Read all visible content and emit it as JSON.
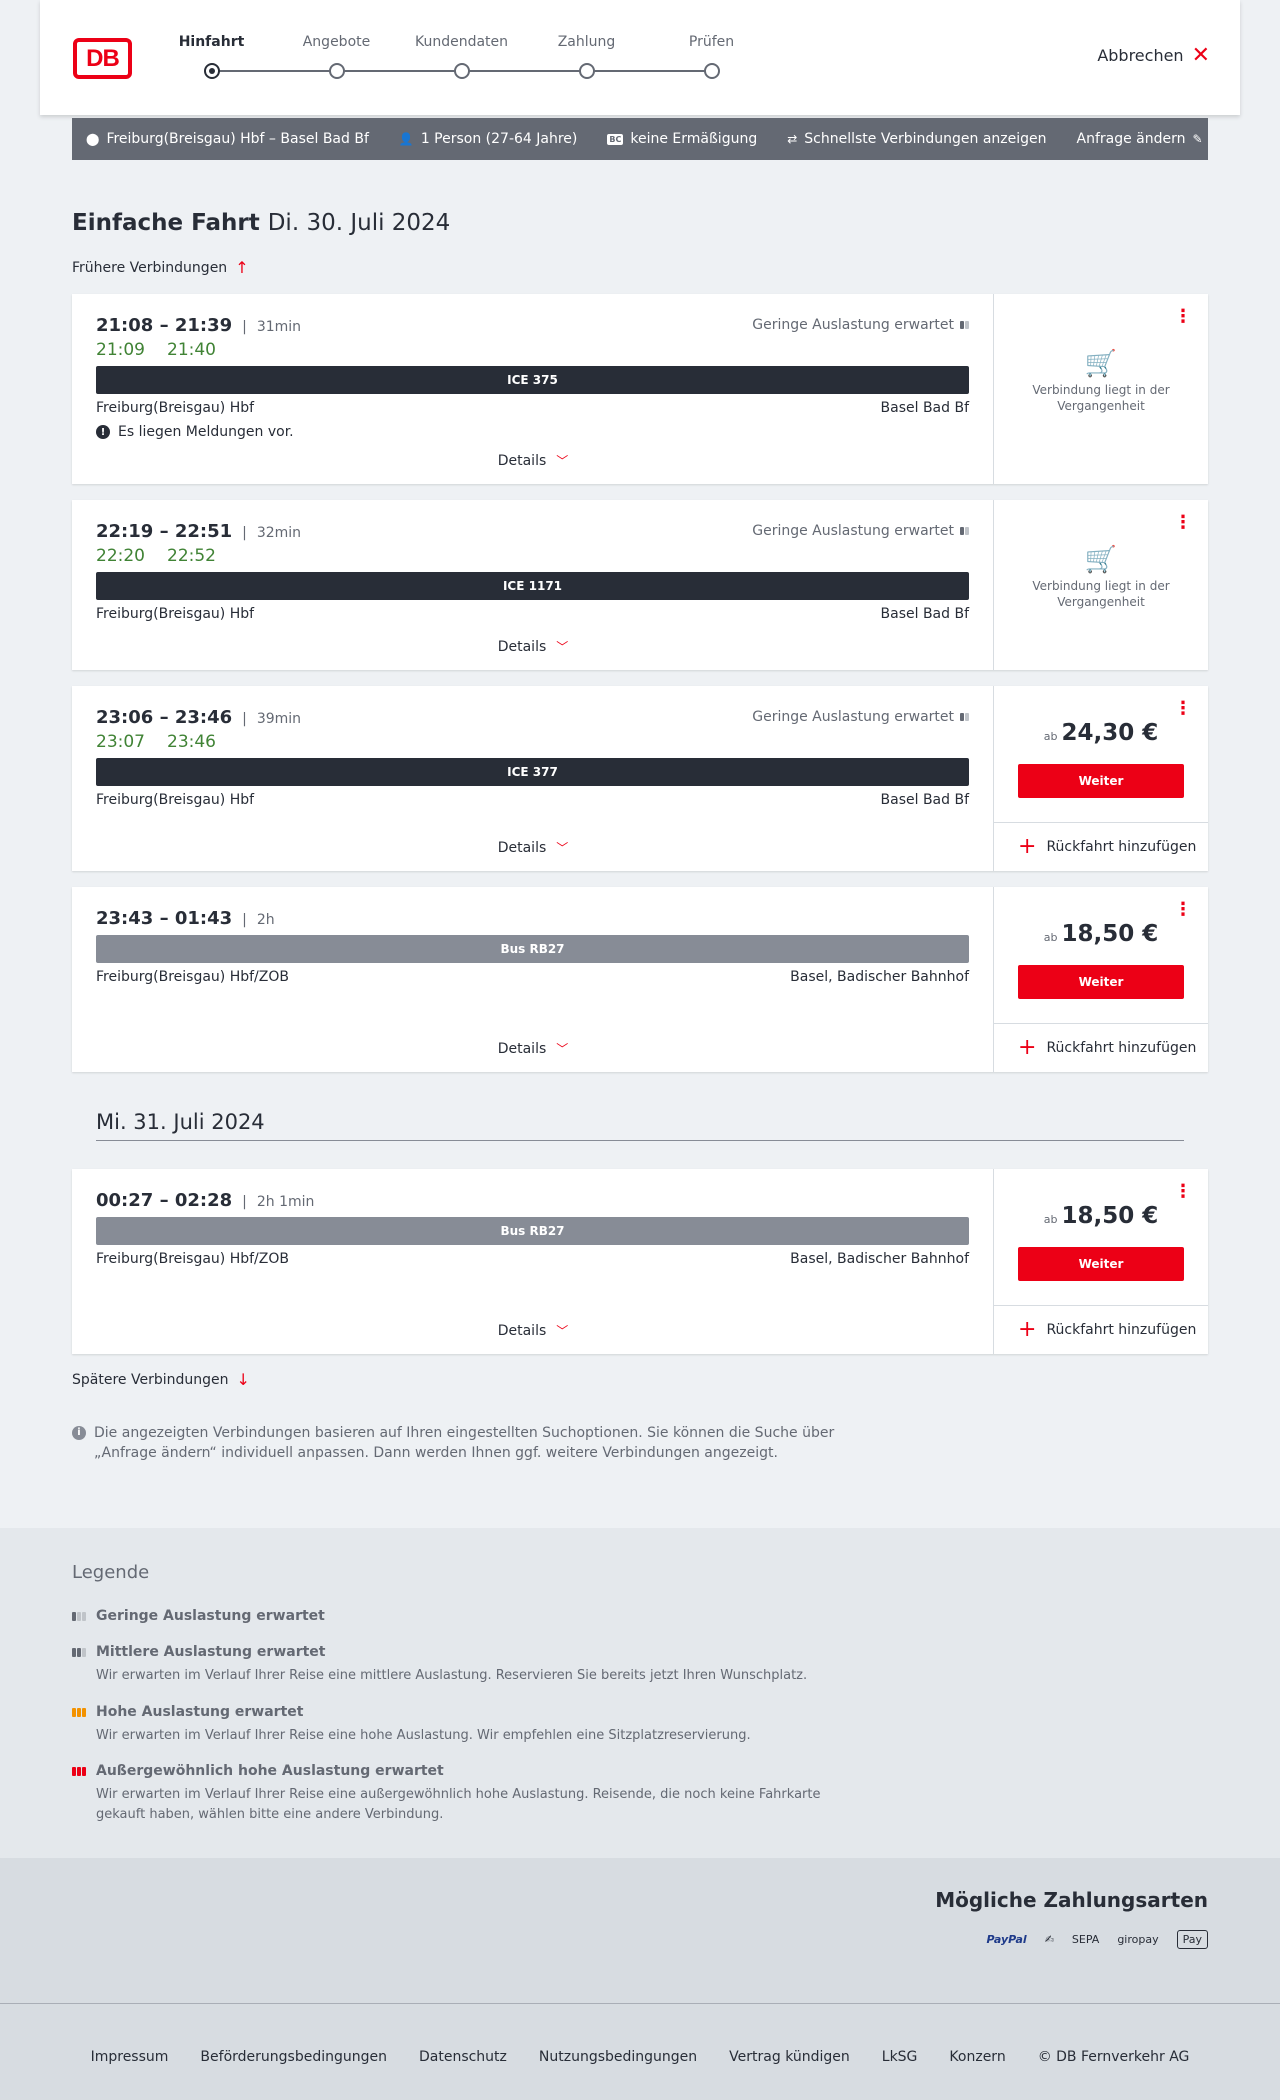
{
  "header": {
    "logo_text": "DB",
    "steps": [
      {
        "label": "Hinfahrt",
        "active": true
      },
      {
        "label": "Angebote",
        "active": false
      },
      {
        "label": "Kundendaten",
        "active": false
      },
      {
        "label": "Zahlung",
        "active": false
      },
      {
        "label": "Prüfen",
        "active": false
      }
    ],
    "cancel_label": "Abbrechen"
  },
  "search": {
    "route": "Freiburg(Breisgau) Hbf – Basel Bad Bf",
    "travelers": "1 Person (27-64 Jahre)",
    "discount_badge": "BC",
    "discount": "keine Ermäßigung",
    "fastest": "Schnellste Verbindungen anzeigen",
    "change": "Anfrage ändern"
  },
  "main": {
    "title_bold": "Einfache Fahrt",
    "title_date": "Di. 30. Juli 2024",
    "earlier": "Frühere Verbindungen",
    "later": "Spätere Verbindungen",
    "second_date": "Mi. 31. Juli 2024",
    "info_note": "Die angezeigten Verbindungen basieren auf Ihren eingestellten Suchoptionen. Sie können die Suche über „Anfrage ändern“ individuell anpassen. Dann werden Ihnen ggf. weitere Verbindungen angezeigt."
  },
  "connections": [
    {
      "times": "21:08 – 21:39",
      "duration": "31min",
      "rt_dep": "21:09",
      "rt_arr": "21:40",
      "occupancy": "Geringe Auslastung erwartet",
      "train": "ICE 375",
      "from": "Freiburg(Breisgau) Hbf",
      "to": "Basel Bad Bf",
      "message": "Es liegen Meldungen vor.",
      "details": "Details",
      "past_text": "Verbindung liegt in der Vergangenheit"
    },
    {
      "times": "22:19 – 22:51",
      "duration": "32min",
      "rt_dep": "22:20",
      "rt_arr": "22:52",
      "occupancy": "Geringe Auslastung erwartet",
      "train": "ICE 1171",
      "from": "Freiburg(Breisgau) Hbf",
      "to": "Basel Bad Bf",
      "details": "Details",
      "past_text": "Verbindung liegt in der Vergangenheit"
    },
    {
      "times": "23:06 – 23:46",
      "duration": "39min",
      "rt_dep": "23:07",
      "rt_arr": "23:46",
      "occupancy": "Geringe Auslastung erwartet",
      "train": "ICE 377",
      "from": "Freiburg(Breisgau) Hbf",
      "to": "Basel Bad Bf",
      "details": "Details",
      "price_prefix": "ab",
      "price": "24,30 €",
      "button": "Weiter",
      "return": "Rückfahrt hinzufügen"
    },
    {
      "times": "23:43 – 01:43",
      "duration": "2h",
      "train": "Bus RB27",
      "from": "Freiburg(Breisgau) Hbf/ZOB",
      "to": "Basel, Badischer Bahnhof",
      "details": "Details",
      "price_prefix": "ab",
      "price": "18,50 €",
      "button": "Weiter",
      "return": "Rückfahrt hinzufügen"
    },
    {
      "times": "00:27 – 02:28",
      "duration": "2h 1min",
      "train": "Bus RB27",
      "from": "Freiburg(Breisgau) Hbf/ZOB",
      "to": "Basel, Badischer Bahnhof",
      "details": "Details",
      "price_prefix": "ab",
      "price": "18,50 €",
      "button": "Weiter",
      "return": "Rückfahrt hinzufügen"
    }
  ],
  "legend": {
    "title": "Legende",
    "items": [
      {
        "label": "Geringe Auslastung erwartet",
        "desc": ""
      },
      {
        "label": "Mittlere Auslastung erwartet",
        "desc": "Wir erwarten im Verlauf Ihrer Reise eine mittlere Auslastung. Reservieren Sie bereits jetzt Ihren Wunschplatz."
      },
      {
        "label": "Hohe Auslastung erwartet",
        "desc": "Wir erwarten im Verlauf Ihrer Reise eine hohe Auslastung. Wir empfehlen eine Sitzplatzreservierung."
      },
      {
        "label": "Außergewöhnlich hohe Auslastung erwartet",
        "desc": "Wir erwarten im Verlauf Ihrer Reise eine außergewöhnlich hohe Auslastung. Reisende, die noch keine Fahrkarte gekauft haben, wählen bitte eine andere Verbindung."
      }
    ]
  },
  "payment": {
    "title": "Mögliche Zahlungsarten",
    "methods": [
      "PayPal",
      "✍",
      "SEPA",
      "giropay",
      "Pay"
    ]
  },
  "footer": {
    "links": [
      "Impressum",
      "Beförderungsbedingungen",
      "Datenschutz",
      "Nutzungsbedingungen",
      "Vertrag kündigen",
      "LkSG",
      "Konzern"
    ],
    "copyright": "© DB Fernverkehr AG"
  },
  "colors": {
    "brand_red": "#ec0016",
    "realtime_green": "#408335",
    "bar_dark": "#282d37",
    "bar_bus": "#878c96"
  }
}
